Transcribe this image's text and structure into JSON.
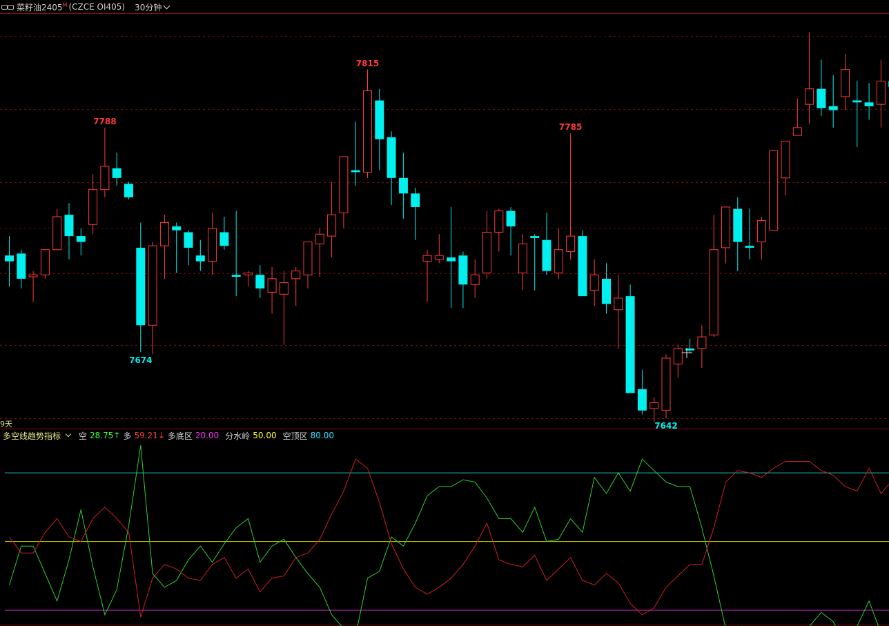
{
  "header": {
    "symbol_name": "菜籽油2405",
    "badge": "M",
    "symbol_code": "(CZCE OI405)",
    "period": "30分钟"
  },
  "days_label": "9天",
  "indicator": {
    "name": "多空线趋势指标",
    "items": [
      {
        "key": "空",
        "value": "28.75↑",
        "color": "#3cff3c"
      },
      {
        "key": "多",
        "value": "59.21↓",
        "color": "#ff3b3b"
      },
      {
        "key": "多底区",
        "value": "20.00",
        "color": "#ff30ff"
      },
      {
        "key": "分水岭",
        "value": "50.00",
        "color": "#ffff30"
      },
      {
        "key": "空顶区",
        "value": "80.00",
        "color": "#30e0ff"
      }
    ]
  },
  "price_labels": [
    {
      "text": "7788",
      "kind": "high",
      "index": 8
    },
    {
      "text": "7674",
      "kind": "low",
      "index": 11
    },
    {
      "text": "7815",
      "kind": "high",
      "index": 30
    },
    {
      "text": "7785",
      "kind": "high",
      "index": 47
    },
    {
      "text": "7642",
      "kind": "low",
      "index": 55
    }
  ],
  "colors": {
    "up": "#ff3b3b",
    "down": "#00f0f0",
    "grid": "#7a0a0a",
    "frame": "#8a1010",
    "zone_top": "#20c0c0",
    "zone_mid": "#d0d000",
    "zone_bottom": "#c020c0"
  },
  "chart_data": {
    "type": "candlestick",
    "price_range": [
      7638,
      7846
    ],
    "candles": [
      [
        7722,
        7732,
        7706,
        7719
      ],
      [
        7723,
        7725,
        7705,
        7710
      ],
      [
        7711,
        7714,
        7698,
        7712
      ],
      [
        7712,
        7725,
        7710,
        7725
      ],
      [
        7725,
        7746,
        7725,
        7742
      ],
      [
        7743,
        7749,
        7720,
        7732
      ],
      [
        7732,
        7736,
        7722,
        7729
      ],
      [
        7738,
        7764,
        7733,
        7756
      ],
      [
        7756,
        7788,
        7752,
        7768
      ],
      [
        7767,
        7775,
        7758,
        7762
      ],
      [
        7759,
        7760,
        7751,
        7752
      ],
      [
        7726,
        7739,
        7672,
        7686
      ],
      [
        7686,
        7729,
        7671,
        7727
      ],
      [
        7727,
        7743,
        7710,
        7739
      ],
      [
        7737,
        7739,
        7713,
        7735
      ],
      [
        7734,
        7735,
        7717,
        7726
      ],
      [
        7722,
        7730,
        7714,
        7719
      ],
      [
        7719,
        7744,
        7712,
        7736
      ],
      [
        7734,
        7742,
        7725,
        7727
      ],
      [
        7712,
        7745,
        7701,
        7711
      ],
      [
        7712,
        7714,
        7706,
        7713
      ],
      [
        7712,
        7717,
        7700,
        7705
      ],
      [
        7703,
        7716,
        7692,
        7710
      ],
      [
        7702,
        7714,
        7676,
        7708
      ],
      [
        7710,
        7716,
        7696,
        7714
      ],
      [
        7712,
        7727,
        7705,
        7729
      ],
      [
        7728,
        7736,
        7711,
        7733
      ],
      [
        7732,
        7760,
        7721,
        7743
      ],
      [
        7744,
        7770,
        7736,
        7773
      ],
      [
        7766,
        7791,
        7758,
        7765
      ],
      [
        7765,
        7818,
        7762,
        7807
      ],
      [
        7802,
        7808,
        7766,
        7782
      ],
      [
        7783,
        7786,
        7748,
        7762
      ],
      [
        7762,
        7775,
        7741,
        7754
      ],
      [
        7754,
        7757,
        7730,
        7747
      ],
      [
        7719,
        7725,
        7698,
        7722
      ],
      [
        7720,
        7733,
        7718,
        7722
      ],
      [
        7721,
        7747,
        7695,
        7719
      ],
      [
        7722,
        7724,
        7695,
        7707
      ],
      [
        7707,
        7720,
        7700,
        7712
      ],
      [
        7713,
        7745,
        7710,
        7734
      ],
      [
        7734,
        7746,
        7724,
        7745
      ],
      [
        7745,
        7747,
        7722,
        7737
      ],
      [
        7713,
        7733,
        7704,
        7728
      ],
      [
        7732,
        7733,
        7704,
        7731
      ],
      [
        7730,
        7744,
        7712,
        7714
      ],
      [
        7713,
        7736,
        7710,
        7725
      ],
      [
        7724,
        7785,
        7720,
        7732
      ],
      [
        7732,
        7735,
        7702,
        7701
      ],
      [
        7704,
        7720,
        7696,
        7712
      ],
      [
        7710,
        7718,
        7692,
        7697
      ],
      [
        7694,
        7712,
        7674,
        7700
      ],
      [
        7701,
        7707,
        7658,
        7651
      ],
      [
        7653,
        7663,
        7640,
        7642
      ],
      [
        7643,
        7649,
        7636,
        7646
      ],
      [
        7642,
        7671,
        7638,
        7669
      ],
      [
        7666,
        7676,
        7659,
        7674
      ],
      [
        7674,
        7679,
        7672,
        7673
      ],
      [
        7674,
        7686,
        7664,
        7680
      ],
      [
        7681,
        7743,
        7680,
        7725
      ],
      [
        7726,
        7739,
        7718,
        7747
      ],
      [
        7746,
        7752,
        7714,
        7729
      ],
      [
        7727,
        7746,
        7720,
        7726
      ],
      [
        7729,
        7742,
        7720,
        7740
      ],
      [
        7735,
        7763,
        7735,
        7776
      ],
      [
        7762,
        7781,
        7753,
        7781
      ],
      [
        7784,
        7803,
        7785,
        7788
      ],
      [
        7800,
        7837,
        7790,
        7808
      ],
      [
        7808,
        7823,
        7794,
        7798
      ],
      [
        7799,
        7815,
        7788,
        7797
      ],
      [
        7804,
        7826,
        7797,
        7818
      ],
      [
        7802,
        7812,
        7778,
        7801
      ],
      [
        7801,
        7811,
        7792,
        7799
      ],
      [
        7800,
        7823,
        7788,
        7812
      ],
      [
        7812,
        7838,
        7789,
        7809
      ]
    ],
    "indicator_range": [
      14,
      93
    ],
    "indicator_lines": [
      {
        "name": "空",
        "color": "#30d030",
        "values": [
          31,
          48,
          48,
          36,
          24,
          42,
          64,
          39,
          18,
          29,
          57,
          92,
          36,
          30,
          33,
          42,
          48,
          41,
          49,
          56,
          60,
          41,
          48,
          51,
          43,
          36,
          30,
          18,
          12,
          9,
          34,
          37,
          52,
          48,
          58,
          70,
          74,
          74,
          77,
          76,
          69,
          60,
          60,
          54,
          65,
          50,
          51,
          60,
          54,
          78,
          71,
          80,
          72,
          86,
          81,
          76,
          74,
          74,
          56,
          35,
          12,
          13,
          12,
          4,
          12,
          1,
          3,
          13,
          19,
          15,
          5,
          13,
          24,
          10,
          12
        ]
      },
      {
        "name": "多",
        "color": "#d02020",
        "values": [
          52,
          45,
          45,
          54,
          60,
          52,
          50,
          60,
          65,
          60,
          54,
          17,
          34,
          40,
          38,
          34,
          33,
          40,
          43,
          34,
          38,
          28,
          34,
          35,
          43,
          45,
          51,
          62,
          72,
          86,
          82,
          67,
          49,
          38,
          30,
          27,
          30,
          34,
          40,
          48,
          58,
          42,
          40,
          39,
          44,
          33,
          38,
          43,
          33,
          31,
          36,
          32,
          23,
          18,
          21,
          30,
          35,
          40,
          40,
          56,
          76,
          81,
          80,
          78,
          82,
          85,
          85,
          85,
          81,
          79,
          74,
          72,
          82,
          71,
          77
        ]
      }
    ]
  }
}
